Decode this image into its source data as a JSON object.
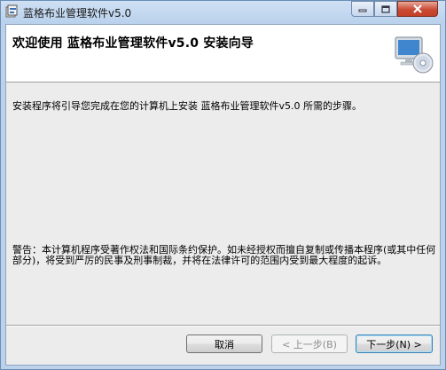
{
  "window": {
    "title": "蓝格布业管理软件v5.0"
  },
  "header": {
    "title": "欢迎使用 蓝格布业管理软件v5.0 安装向导"
  },
  "body": {
    "intro": "安装程序将引导您完成在您的计算机上安装 蓝格布业管理软件v5.0 所需的步骤。",
    "warning": "警告：本计算机程序受著作权法和国际条约保护。如未经授权而擅自复制或传播本程序(或其中任何部分)，将受到严厉的民事及刑事制裁，并将在法律许可的范围内受到最大程度的起诉。"
  },
  "buttons": {
    "cancel": "取消",
    "back": "< 上一步(B)",
    "next": "下一步(N) >"
  },
  "icons": {
    "title": "installer-icon",
    "header": "computer-cd-icon"
  }
}
